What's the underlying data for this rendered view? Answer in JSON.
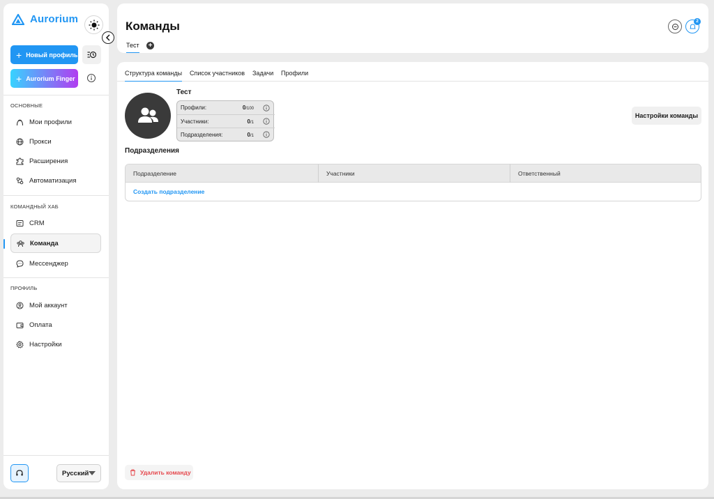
{
  "app": {
    "brand": "Aurorium",
    "accent": "#2196f3"
  },
  "sidebar": {
    "new_profile_label": "Новый профиль",
    "finger_label": "Aurorium Finger",
    "sections": [
      {
        "title": "ОСНОВНЫЕ",
        "items": [
          {
            "label": "Мои профили",
            "icon": "user-icon"
          },
          {
            "label": "Прокси",
            "icon": "globe-icon"
          },
          {
            "label": "Расширения",
            "icon": "puzzle-icon"
          },
          {
            "label": "Автоматизация",
            "icon": "automation-icon"
          }
        ]
      },
      {
        "title": "КОМАНДНЫЙ ХАБ",
        "items": [
          {
            "label": "CRM",
            "icon": "crm-icon"
          },
          {
            "label": "Команда",
            "icon": "team-icon",
            "active": true
          },
          {
            "label": "Мессенджер",
            "icon": "chat-icon"
          }
        ]
      },
      {
        "title": "ПРОФИЛЬ",
        "items": [
          {
            "label": "Мой аккаунт",
            "icon": "account-icon"
          },
          {
            "label": "Оплата",
            "icon": "wallet-icon"
          },
          {
            "label": "Настройки",
            "icon": "gear-icon"
          }
        ]
      }
    ],
    "language": "Русский"
  },
  "header": {
    "title": "Команды",
    "team_tab": "Тест",
    "notification_count": "2"
  },
  "main": {
    "tabs": [
      "Структура команды",
      "Список участников",
      "Задачи",
      "Профили"
    ],
    "active_tab": 0,
    "team_name": "Тест",
    "stats": [
      {
        "label": "Профили:",
        "value": "0",
        "limit": "/100"
      },
      {
        "label": "Участники:",
        "value": "0",
        "limit": "/1"
      },
      {
        "label": "Подразделения:",
        "value": "0",
        "limit": "/1"
      }
    ],
    "settings_button": "Настройки команды",
    "divisions_title": "Подразделения",
    "table_columns": [
      "Подразделение",
      "Участники",
      "Ответственный"
    ],
    "create_division_link": "Создать подразделение",
    "delete_team_button": "Удалить команду"
  }
}
